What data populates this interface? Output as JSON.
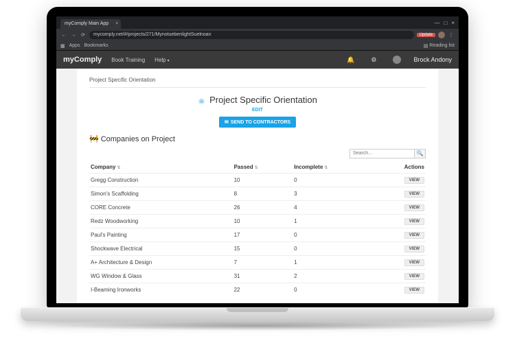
{
  "chrome": {
    "tab_title": "myComply Main App",
    "url": "mycomply.net/#/projects/271/MynotuebenlightSuelnoan",
    "update_badge": "Update",
    "apps": "Apps",
    "bookmarks": "Bookmarks",
    "reading_list": "Reading list"
  },
  "header": {
    "brand_prefix": "my",
    "brand_bold": "Comply",
    "nav1": "Book Training",
    "nav2": "Help",
    "user": "Brock Andony"
  },
  "page": {
    "breadcrumb": "Project Specific Orientation",
    "title": "Project Specific Orientation",
    "edit": "EDIT",
    "send": "SEND TO CONTRACTORS",
    "section": "Companies on Project",
    "search_placeholder": "Search...",
    "cols": {
      "company": "Company",
      "passed": "Passed",
      "incomplete": "Incomplete",
      "actions": "Actions"
    },
    "view": "VIEW",
    "rows": [
      {
        "c": "Gregg Construction",
        "p": "10",
        "i": "0"
      },
      {
        "c": "Simon's Scaffolding",
        "p": "8",
        "i": "3"
      },
      {
        "c": "CORE Concrete",
        "p": "26",
        "i": "4"
      },
      {
        "c": "Redz Woodworking",
        "p": "10",
        "i": "1"
      },
      {
        "c": "Paul's Painting",
        "p": "17",
        "i": "0"
      },
      {
        "c": "Shockwave Electrical",
        "p": "15",
        "i": "0"
      },
      {
        "c": "A+ Architecture & Design",
        "p": "7",
        "i": "1"
      },
      {
        "c": "WG Window & Glass",
        "p": "31",
        "i": "2"
      },
      {
        "c": "I-Beaming Ironworks",
        "p": "22",
        "i": "0"
      }
    ]
  }
}
